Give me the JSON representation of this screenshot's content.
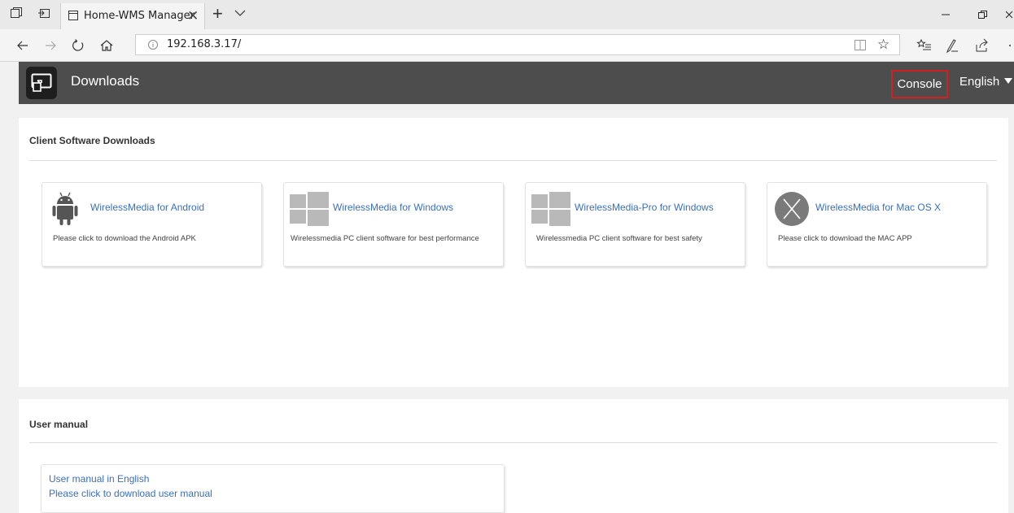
{
  "browser": {
    "tab_title": "Home-WMS Manager",
    "tab_close": "✕",
    "new_tab": "+",
    "url": "192.168.3.17/",
    "favorite_glyph": "☆"
  },
  "header": {
    "title": "Downloads",
    "console_label": "Console",
    "language": "English",
    "bg_color": "#4d4d4d",
    "highlight_color": "#d21f1f"
  },
  "downloads": {
    "title": "Client Software Downloads",
    "cards": [
      {
        "icon": "android-icon",
        "label": "WirelessMedia for Android",
        "desc": "Please click to download the Android APK"
      },
      {
        "icon": "windows-icon",
        "label": "WirelessMedia for Windows",
        "desc": " Wirelessmedia PC client software for best performance"
      },
      {
        "icon": "windows-icon",
        "label": "WirelessMedia-Pro for Windows",
        "desc": "Wirelessmedia PC client software for best safety"
      },
      {
        "icon": "mac-os-x-icon",
        "label": "WirelessMedia for Mac OS X",
        "desc": "Please click to download the MAC APP"
      }
    ]
  },
  "manual": {
    "title": "User manual",
    "link_title": "User manual in English",
    "link_desc": "Please click to download user manual"
  }
}
